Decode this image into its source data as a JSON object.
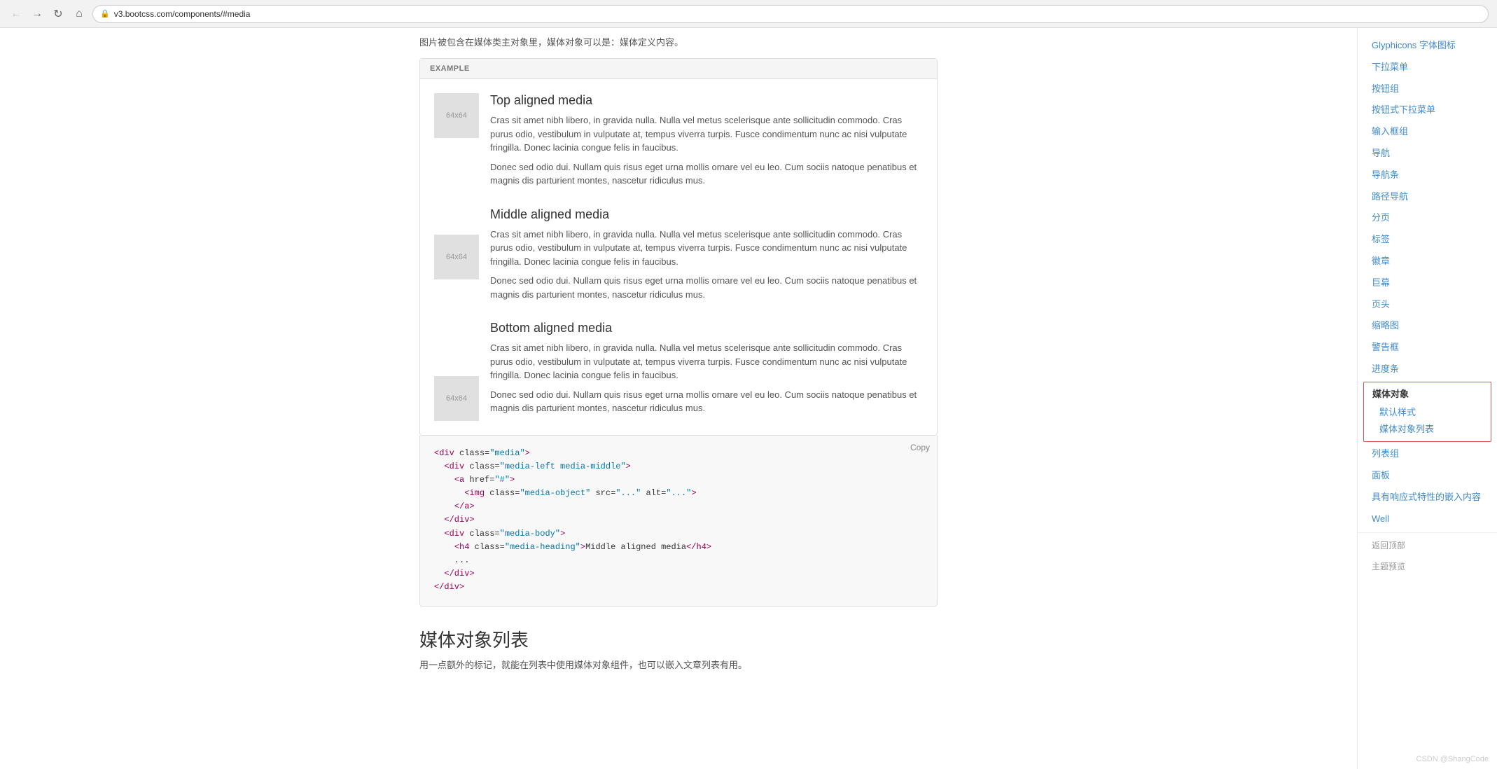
{
  "browser": {
    "url": "v3.bootcss.com/components/#media",
    "lock_icon": "🔒"
  },
  "top_text": "图片被包含在媒体类主对象里，媒体对象可以是：媒体定义内容。",
  "example_label": "EXAMPLE",
  "media_items": [
    {
      "id": "top",
      "heading": "Top aligned media",
      "thumb_label": "64x64",
      "thumb_align": "top",
      "para1": "Cras sit amet nibh libero, in gravida nulla. Nulla vel metus scelerisque ante sollicitudin commodo. Cras purus odio, vestibulum in vulputate at, tempus viverra turpis. Fusce condimentum nunc ac nisi vulputate fringilla. Donec lacinia congue felis in faucibus.",
      "para2": "Donec sed odio dui. Nullam quis risus eget urna mollis ornare vel eu leo. Cum sociis natoque penatibus et magnis dis parturient montes, nascetur ridiculus mus."
    },
    {
      "id": "middle",
      "heading": "Middle aligned media",
      "thumb_label": "64x64",
      "thumb_align": "middle",
      "para1": "Cras sit amet nibh libero, in gravida nulla. Nulla vel metus scelerisque ante sollicitudin commodo. Cras purus odio, vestibulum in vulputate at, tempus viverra turpis. Fusce condimentum nunc ac nisi vulputate fringilla. Donec lacinia congue felis in faucibus.",
      "para2": "Donec sed odio dui. Nullam quis risus eget urna mollis ornare vel eu leo. Cum sociis natoque penatibus et magnis dis parturient montes, nascetur ridiculus mus."
    },
    {
      "id": "bottom",
      "heading": "Bottom aligned media",
      "thumb_label": "64x64",
      "thumb_align": "bottom",
      "para1": "Cras sit amet nibh libero, in gravida nulla. Nulla vel metus scelerisque ante sollicitudin commodo. Cras purus odio, vestibulum in vulputate at, tempus viverra turpis. Fusce condimentum nunc ac nisi vulputate fringilla. Donec lacinia congue felis in faucibus.",
      "para2": "Donec sed odio dui. Nullam quis risus eget urna mollis ornare vel eu leo. Cum sociis natoque penatibus et magnis dis parturient montes, nascetur ridiculus mus."
    }
  ],
  "code": {
    "copy_label": "Copy",
    "lines": [
      {
        "indent": 0,
        "html": "&lt;div class=<span class='val'>\"media\"</span>&gt;"
      },
      {
        "indent": 1,
        "html": "&lt;div class=<span class='val'>\"media-left media-middle\"</span>&gt;"
      },
      {
        "indent": 2,
        "html": "&lt;a href=<span class='val'>\"#\"</span>&gt;"
      },
      {
        "indent": 3,
        "html": "&lt;img class=<span class='val'>\"media-object\"</span> src=<span class='val'>\"...\"</span> alt=<span class='val'>\"...\"</span>&gt;"
      },
      {
        "indent": 2,
        "html": "&lt;/a&gt;"
      },
      {
        "indent": 1,
        "html": "&lt;/div&gt;"
      },
      {
        "indent": 1,
        "html": "&lt;div class=<span class='val'>\"media-body\"</span>&gt;"
      },
      {
        "indent": 2,
        "html": "&lt;h4 class=<span class='val'>\"media-heading\"</span>&gt;Middle aligned media&lt;/h4&gt;"
      },
      {
        "indent": 2,
        "html": "..."
      },
      {
        "indent": 1,
        "html": "&lt;/div&gt;"
      },
      {
        "indent": 0,
        "html": "&lt;/div&gt;"
      }
    ]
  },
  "section_heading": "媒体对象列表",
  "section_desc": "用一点额外的标记，就能在列表中使用媒体对象组件，也可以嵌入文章列表有用。",
  "sidebar": {
    "items": [
      {
        "id": "glyphicons",
        "label": "Glyphicons 字体图标",
        "sub": false
      },
      {
        "id": "dropdown",
        "label": "下拉菜单",
        "sub": false
      },
      {
        "id": "btn-group",
        "label": "按钮组",
        "sub": false
      },
      {
        "id": "btn-dropdown",
        "label": "按钮式下拉菜单",
        "sub": false
      },
      {
        "id": "input-group",
        "label": "输入框组",
        "sub": false
      },
      {
        "id": "nav",
        "label": "导航",
        "sub": false
      },
      {
        "id": "navbar",
        "label": "导航条",
        "sub": false
      },
      {
        "id": "breadcrumb",
        "label": "路径导航",
        "sub": false
      },
      {
        "id": "pagination",
        "label": "分页",
        "sub": false
      },
      {
        "id": "labels",
        "label": "标签",
        "sub": false
      },
      {
        "id": "badges",
        "label": "徽章",
        "sub": false
      },
      {
        "id": "jumbotron",
        "label": "巨幕",
        "sub": false
      },
      {
        "id": "page-header",
        "label": "页头",
        "sub": false
      },
      {
        "id": "thumbnails",
        "label": "缩略图",
        "sub": false
      },
      {
        "id": "alerts",
        "label": "警告框",
        "sub": false
      },
      {
        "id": "progress",
        "label": "进度条",
        "sub": false
      },
      {
        "id": "media",
        "label": "媒体对象",
        "sub": false,
        "active": true
      },
      {
        "id": "media-default",
        "label": "默认样式",
        "sub": true
      },
      {
        "id": "media-list",
        "label": "媒体对象列表",
        "sub": true
      },
      {
        "id": "list-group",
        "label": "列表组",
        "sub": false
      },
      {
        "id": "panels",
        "label": "面板",
        "sub": false
      },
      {
        "id": "responsive-embed",
        "label": "具有响应式特性的嵌入内容",
        "sub": false
      },
      {
        "id": "wells",
        "label": "Well",
        "sub": false
      },
      {
        "id": "back-to-top",
        "label": "返回顶部",
        "sub": false,
        "special": true
      },
      {
        "id": "theme-preview",
        "label": "主题预览",
        "sub": false,
        "special": true
      }
    ]
  },
  "footer": {
    "watermark": "CSDN @ShangCode"
  }
}
